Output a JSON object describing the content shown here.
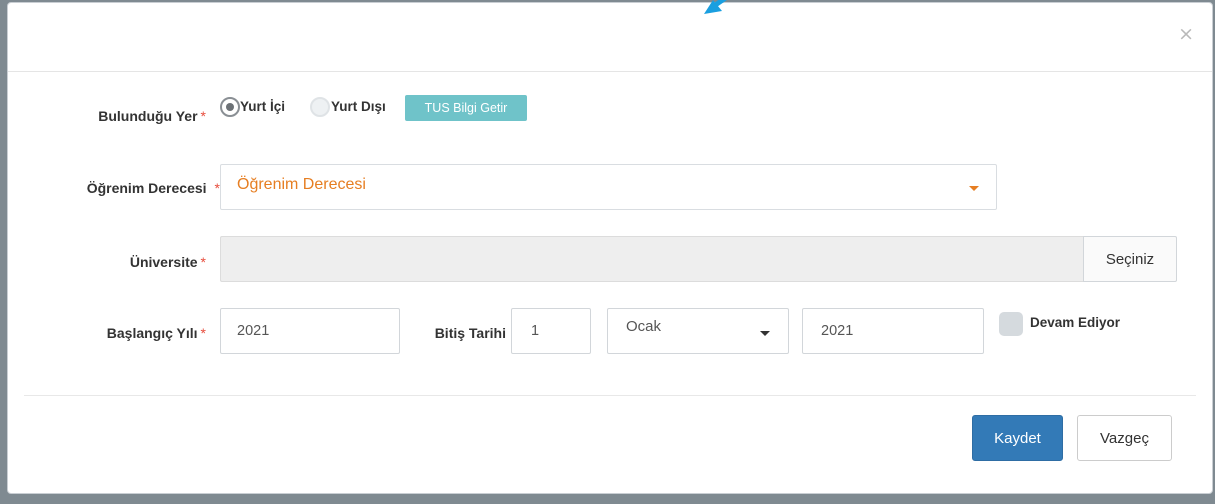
{
  "dialog": {
    "close_glyph": "×"
  },
  "location": {
    "label": "Bulunduğu Yer",
    "required_mark": "*",
    "options": [
      {
        "label": "Yurt İçi",
        "selected": true
      },
      {
        "label": "Yurt Dışı",
        "selected": false
      }
    ],
    "tus_button": "TUS Bilgi Getir"
  },
  "degree": {
    "label": "Öğrenim Derecesi",
    "required_mark": "*",
    "value": "Öğrenim Derecesi",
    "value_color": "#e67e22"
  },
  "university": {
    "label": "Üniversite",
    "required_mark": "*",
    "value": "",
    "select_button": "Seçiniz"
  },
  "dates": {
    "start_label": "Başlangıç Yılı",
    "required_mark": "*",
    "start_year": "2021",
    "end_label": "Bitiş Tarihi",
    "end_day": "1",
    "end_month": "Ocak",
    "end_year": "2021",
    "ongoing_label": "Devam Ediyor",
    "ongoing_checked": false
  },
  "footer": {
    "save": "Kaydet",
    "cancel": "Vazgeç"
  },
  "colors": {
    "primary": "#337ab7",
    "teal": "#6fc3c9",
    "required": "#e74c3c",
    "arrow": "#1a9fe0"
  }
}
